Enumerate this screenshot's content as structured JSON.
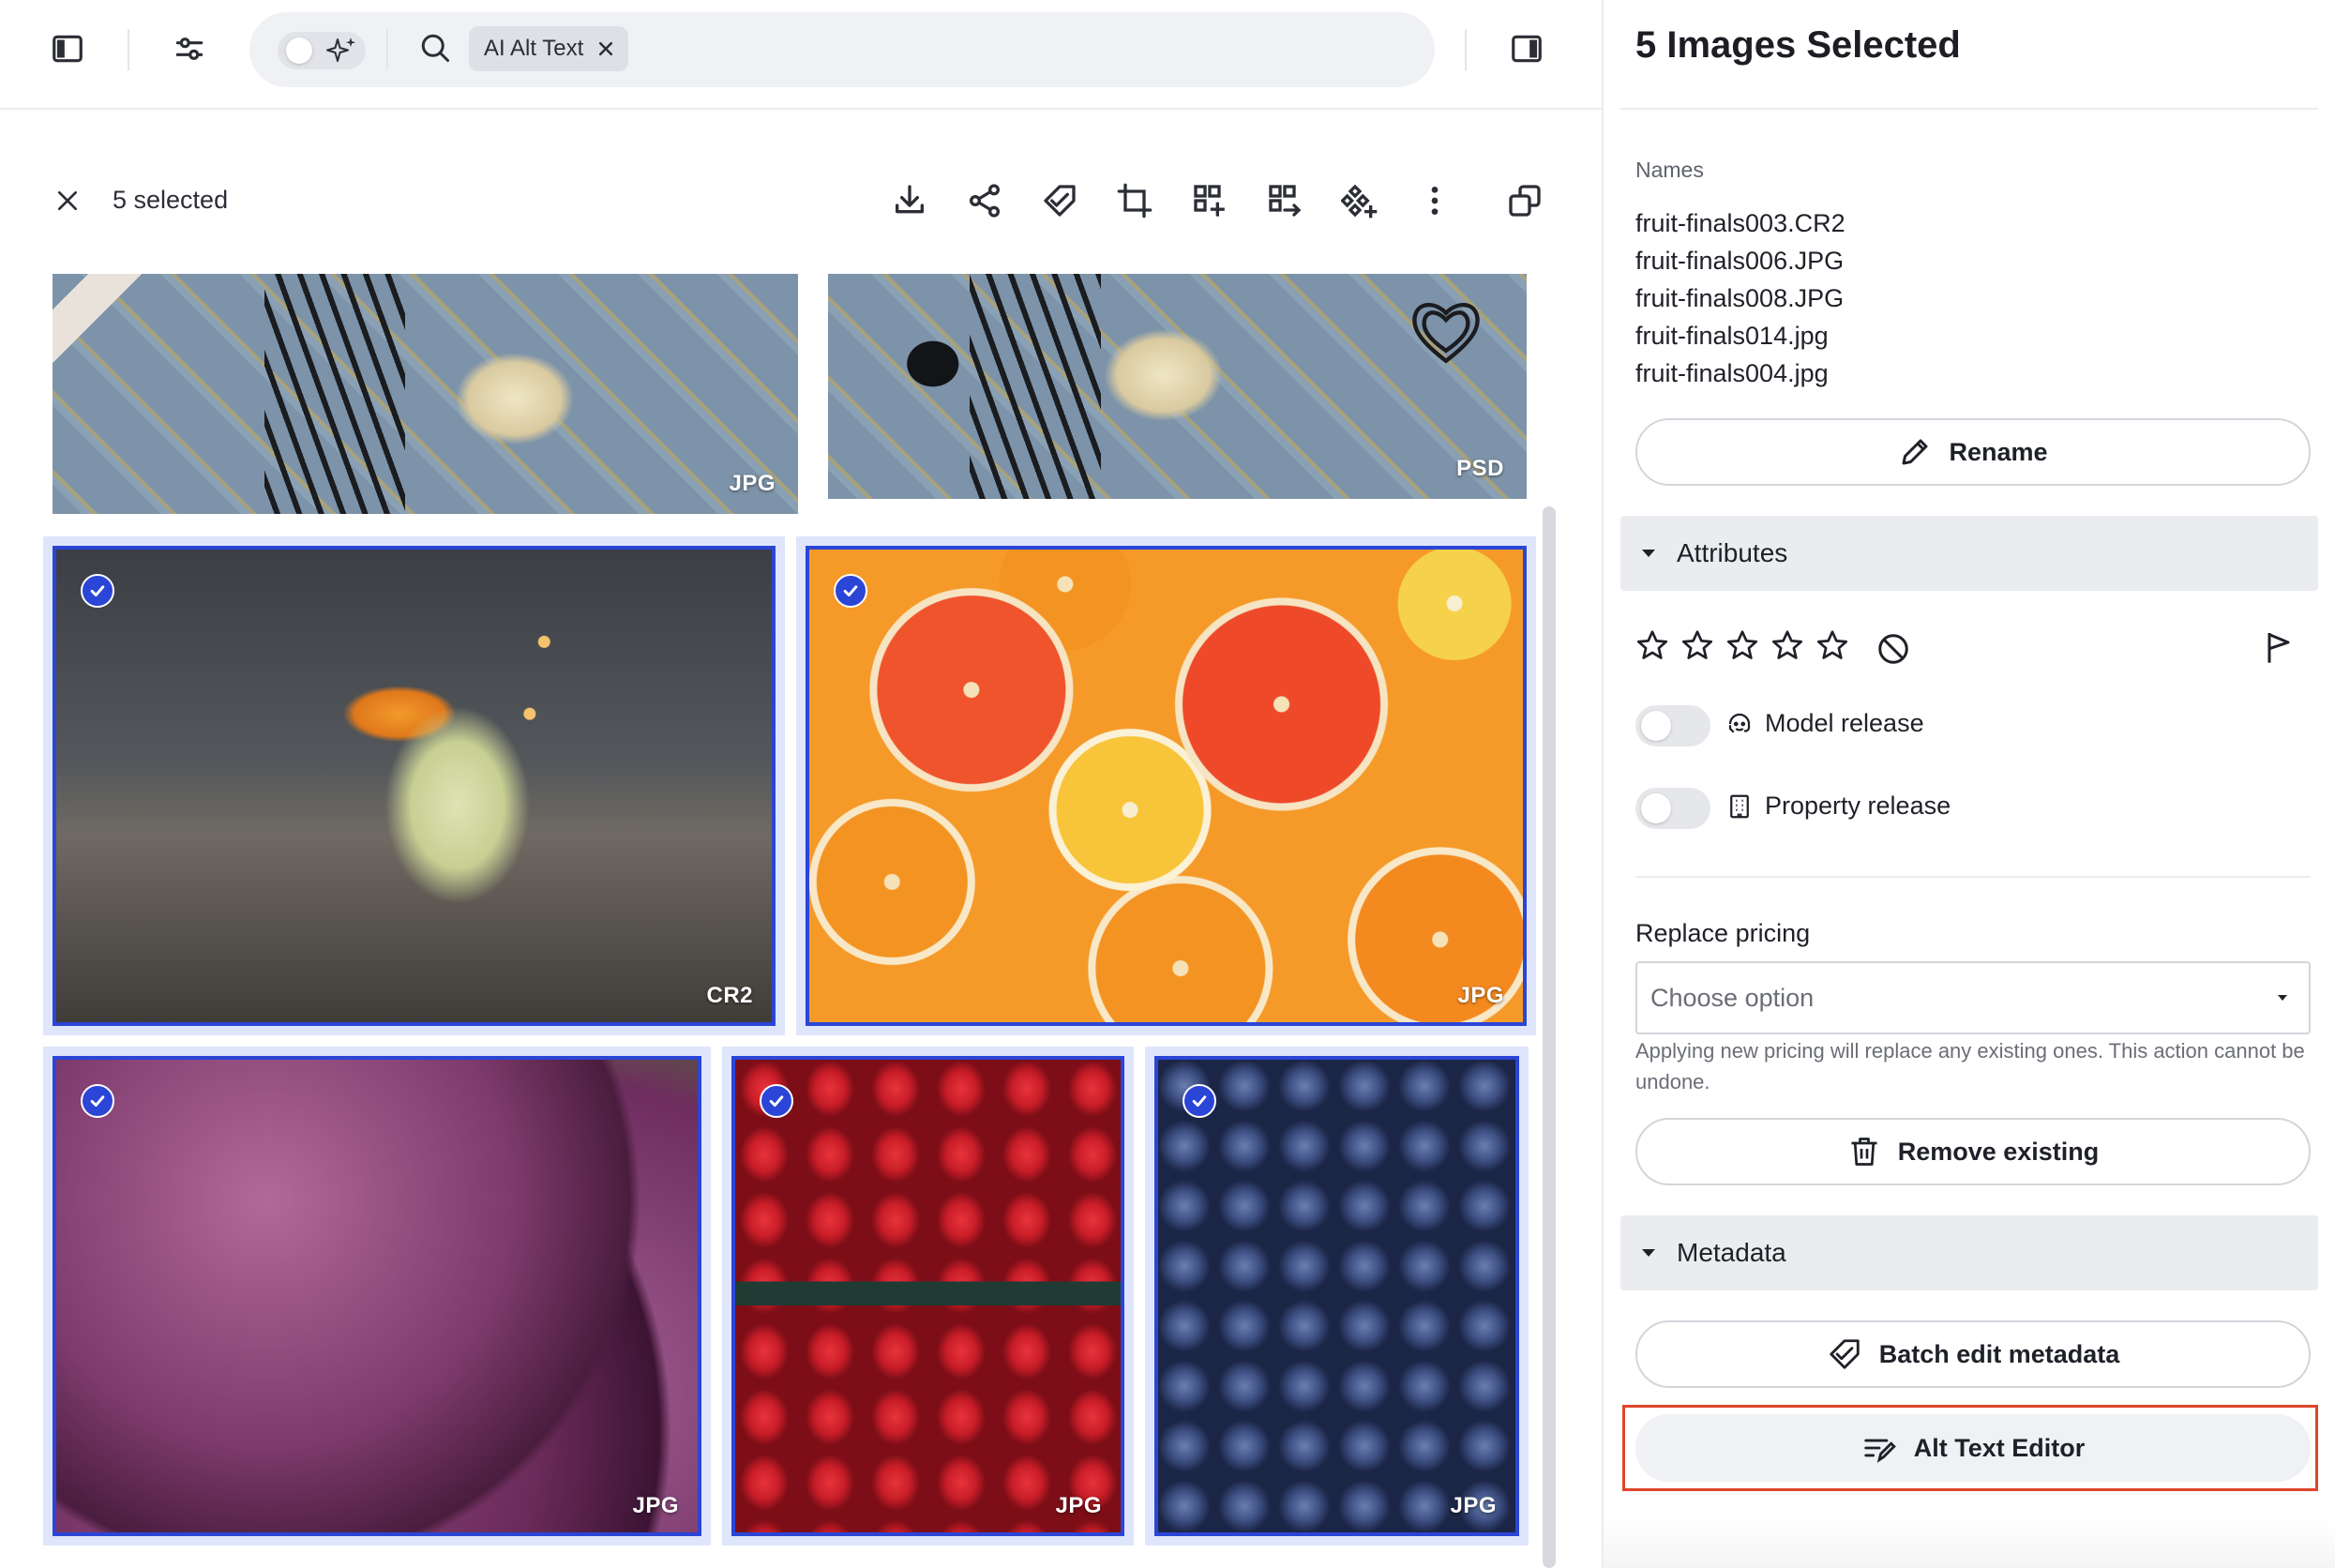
{
  "toolbar": {
    "search": {
      "chip_label": "AI Alt Text"
    }
  },
  "selection": {
    "count_label": "5 selected"
  },
  "grid": {
    "thumbnails": [
      {
        "format": "JPG"
      },
      {
        "format": "PSD"
      },
      {
        "format": "CR2"
      },
      {
        "format": "JPG"
      },
      {
        "format": "JPG"
      },
      {
        "format": "JPG"
      },
      {
        "format": "JPG"
      }
    ]
  },
  "panel": {
    "title": "5 Images Selected",
    "names_label": "Names",
    "names": [
      "fruit-finals003.CR2",
      "fruit-finals006.JPG",
      "fruit-finals008.JPG",
      "fruit-finals014.jpg",
      "fruit-finals004.jpg"
    ],
    "rename_label": "Rename",
    "attributes_label": "Attributes",
    "model_release_label": "Model release",
    "property_release_label": "Property release",
    "pricing_label": "Replace pricing",
    "pricing_placeholder": "Choose option",
    "pricing_help": "Applying new pricing will replace any existing ones. This action cannot be undone.",
    "remove_existing_label": "Remove existing",
    "metadata_label": "Metadata",
    "batch_edit_label": "Batch edit metadata",
    "alt_text_editor_label": "Alt Text Editor"
  },
  "colors": {
    "selection_blue": "#2b45d6",
    "highlight_red": "#e0452b"
  }
}
